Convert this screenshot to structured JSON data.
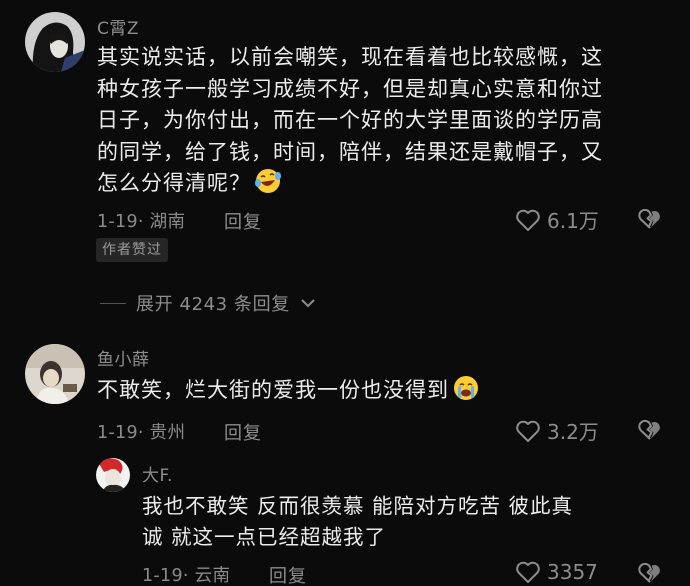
{
  "comments": [
    {
      "username": "C霄Z",
      "lines": [
        "其实说实话，以前会嘲笑，现在看着也比较感慨，这",
        "种女孩子一般学习成绩不好，但是却真心实意和你过",
        "日子，为你付出，而在一个好的大学里面谈的学历高",
        "的同学，给了钱，时间，陪伴，结果还是戴帽子，又",
        "怎么分得清呢？"
      ],
      "emoji": "rofl-emoji",
      "date_location": "1-19· 湖南",
      "reply_label": "回复",
      "likes": "6.1万",
      "badge": "作者赞过"
    },
    {
      "username": "鱼小薛",
      "lines": [
        "不敢笑，烂大街的爱我一份也没得到"
      ],
      "emoji": "crying-emoji",
      "date_location": "1-19· 贵州",
      "reply_label": "回复",
      "likes": "3.2万"
    },
    {
      "username": "大F.",
      "lines": [
        "我也不敢笑 反而很羡慕  能陪对方吃苦   彼此真",
        "诚  就这一点已经超越我了"
      ],
      "date_location": "1-19· 云南",
      "reply_label": "回复",
      "likes": "3357"
    }
  ],
  "expand_label": "展开 4243 条回复",
  "colors": {
    "background": "#0b0b0b",
    "text": "#ececec",
    "muted": "#8d8d8d",
    "badge_bg": "#262626"
  }
}
